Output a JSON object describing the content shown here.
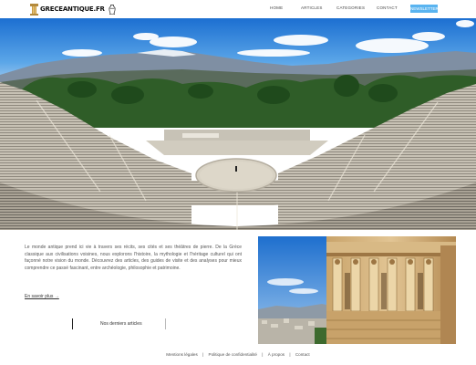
{
  "brand": {
    "name": "GRECEANTIQUE",
    "tld": ".FR"
  },
  "nav": {
    "items": [
      "HOME",
      "ARTICLES",
      "CATEGORIES",
      "CONTACT"
    ],
    "cta": "NEWSLETTER"
  },
  "colors": {
    "accent": "#5ab4f0",
    "text": "#222222",
    "muted": "#555555"
  },
  "hero": {
    "image": "ancient-theatre-of-epidaurus",
    "alt": ""
  },
  "intro": {
    "paragraph": "Le monde antique prend ici vie à travers ses récits, ses cités et ses théâtres de pierre. De la Grèce classique aux civilisations voisines, nous explorons l'histoire, la mythologie et l'héritage culturel qui ont façonné notre vision du monde. Découvrez des articles, des guides de visite et des analyses pour mieux comprendre ce passé fascinant, entre archéologie, philosophie et patrimoine.",
    "read_more": "En savoir plus →",
    "cta_label": "Nos derniers articles"
  },
  "side_image": {
    "image": "erechtheion-caryatids"
  },
  "footer": {
    "links": [
      "Mentions légales",
      "Politique de confidentialité",
      "À propos",
      "Contact"
    ],
    "separator": "|"
  }
}
